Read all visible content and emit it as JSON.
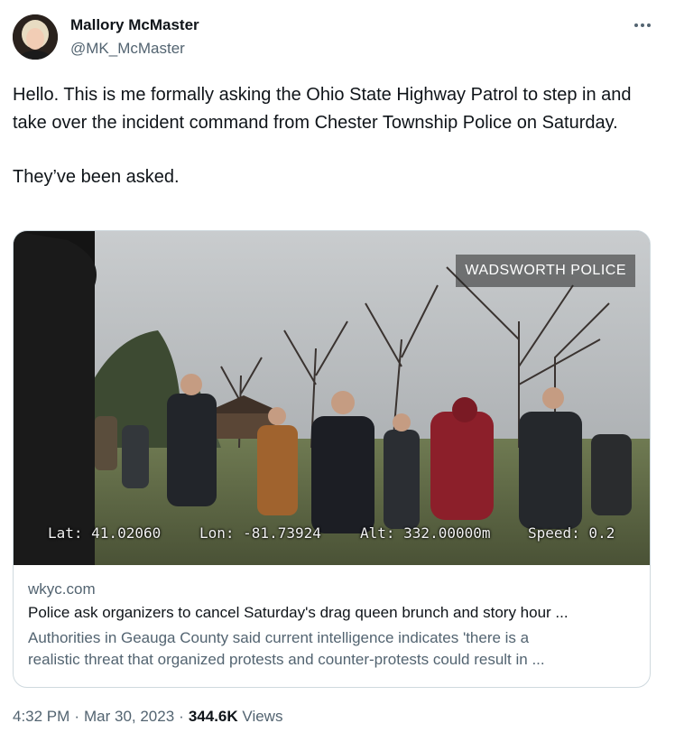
{
  "author": {
    "name": "Mallory McMaster",
    "handle": "@MK_McMaster",
    "avatar_icon": "avatar-photo"
  },
  "more_icon": "more-horizontal-icon",
  "tweet": {
    "paragraph_1": "Hello. This is me formally asking the Ohio State Highway Patrol to step in and take over the incident command from Chester Township Police on Saturday.",
    "paragraph_2": "They’ve been asked."
  },
  "card": {
    "media": {
      "watermark": "WADSWORTH POLICE",
      "lat": "Lat: 41.02060",
      "lon": "Lon: -81.73924",
      "alt": "Alt: 332.00000m",
      "speed": "Speed: 0.2"
    },
    "domain": "wkyc.com",
    "title": "Police ask organizers to cancel Saturday's drag queen brunch and story hour ...",
    "description_line_1": "Authorities in Geauga County said current intelligence indicates 'there is a",
    "description_line_2": "realistic threat that organized protests and counter-protests could result in ..."
  },
  "meta": {
    "time": "4:32 PM",
    "dot_1": "·",
    "date": "Mar 30, 2023",
    "dot_2": "·",
    "views_count": "344.6K",
    "views_label": "Views"
  },
  "colors": {
    "text_primary": "#0f1419",
    "text_secondary": "#536471",
    "border": "#cfd9de"
  }
}
